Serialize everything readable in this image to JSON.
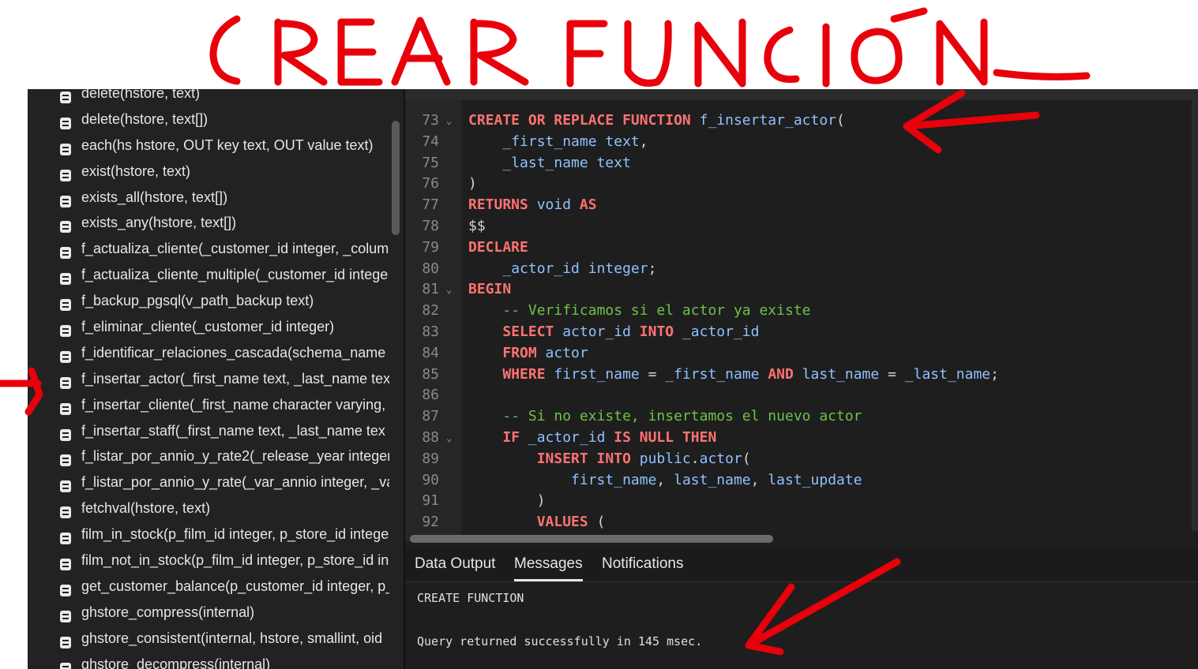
{
  "annotation": {
    "title": "CREAR FUNCIÓN",
    "color": "#e8000a"
  },
  "sidebar": {
    "items": [
      "delete(hstore, text)",
      "delete(hstore, text[])",
      "each(hs hstore, OUT key text, OUT value text)",
      "exist(hstore, text)",
      "exists_all(hstore, text[])",
      "exists_any(hstore, text[])",
      "f_actualiza_cliente(_customer_id integer, _colum",
      "f_actualiza_cliente_multiple(_customer_id intege",
      "f_backup_pgsql(v_path_backup text)",
      "f_eliminar_cliente(_customer_id integer)",
      "f_identificar_relaciones_cascada(schema_name",
      "f_insertar_actor(_first_name text, _last_name tex",
      "f_insertar_cliente(_first_name character varying,",
      "f_insertar_staff(_first_name text, _last_name tex",
      "f_listar_por_annio_y_rate2(_release_year integer,",
      "f_listar_por_annio_y_rate(_var_annio integer, _va",
      "fetchval(hstore, text)",
      "film_in_stock(p_film_id integer, p_store_id intege",
      "film_not_in_stock(p_film_id integer, p_store_id in",
      "get_customer_balance(p_customer_id integer, p_",
      "ghstore_compress(internal)",
      "ghstore_consistent(internal, hstore, smallint, oid",
      "ghstore_decompress(internal)"
    ],
    "icon": "function-icon"
  },
  "editor": {
    "colors": {
      "keyword": "#ff7272",
      "identifier": "#8fc1ff",
      "comment": "#6dc34a"
    },
    "lines": [
      {
        "n": "73",
        "fold": true,
        "tokens": [
          [
            "kw",
            "CREATE OR REPLACE FUNCTION "
          ],
          [
            "id",
            "f_insertar_actor"
          ],
          [
            "op",
            "("
          ]
        ]
      },
      {
        "n": "74",
        "fold": false,
        "tokens": [
          [
            "op",
            "    "
          ],
          [
            "id",
            "_first_name text"
          ],
          [
            "op",
            ","
          ]
        ]
      },
      {
        "n": "75",
        "fold": false,
        "tokens": [
          [
            "op",
            "    "
          ],
          [
            "id",
            "_last_name text"
          ]
        ]
      },
      {
        "n": "76",
        "fold": false,
        "tokens": [
          [
            "op",
            ")"
          ]
        ]
      },
      {
        "n": "77",
        "fold": false,
        "tokens": [
          [
            "kw",
            "RETURNS "
          ],
          [
            "id",
            "void "
          ],
          [
            "kw",
            "AS"
          ]
        ]
      },
      {
        "n": "78",
        "fold": false,
        "tokens": [
          [
            "op",
            "$$"
          ]
        ]
      },
      {
        "n": "79",
        "fold": false,
        "tokens": [
          [
            "kw",
            "DECLARE"
          ]
        ]
      },
      {
        "n": "80",
        "fold": false,
        "tokens": [
          [
            "op",
            "    "
          ],
          [
            "id",
            "_actor_id integer"
          ],
          [
            "op",
            ";"
          ]
        ]
      },
      {
        "n": "81",
        "fold": true,
        "tokens": [
          [
            "kw",
            "BEGIN"
          ]
        ]
      },
      {
        "n": "82",
        "fold": false,
        "tokens": [
          [
            "op",
            "    "
          ],
          [
            "cm",
            "-- Verificamos si el actor ya existe"
          ]
        ]
      },
      {
        "n": "83",
        "fold": false,
        "tokens": [
          [
            "op",
            "    "
          ],
          [
            "kw",
            "SELECT "
          ],
          [
            "id",
            "actor_id "
          ],
          [
            "kw",
            "INTO "
          ],
          [
            "id",
            "_actor_id"
          ]
        ]
      },
      {
        "n": "84",
        "fold": false,
        "tokens": [
          [
            "op",
            "    "
          ],
          [
            "kw",
            "FROM "
          ],
          [
            "id",
            "actor"
          ]
        ]
      },
      {
        "n": "85",
        "fold": false,
        "tokens": [
          [
            "op",
            "    "
          ],
          [
            "kw",
            "WHERE "
          ],
          [
            "id",
            "first_name "
          ],
          [
            "op",
            "= "
          ],
          [
            "id",
            "_first_name "
          ],
          [
            "kw",
            "AND "
          ],
          [
            "id",
            "last_name "
          ],
          [
            "op",
            "= "
          ],
          [
            "id",
            "_last_name"
          ],
          [
            "op",
            ";"
          ]
        ]
      },
      {
        "n": "86",
        "fold": false,
        "tokens": []
      },
      {
        "n": "87",
        "fold": false,
        "tokens": [
          [
            "op",
            "    "
          ],
          [
            "cm",
            "-- Si no existe, insertamos el nuevo actor"
          ]
        ]
      },
      {
        "n": "88",
        "fold": true,
        "tokens": [
          [
            "op",
            "    "
          ],
          [
            "kw",
            "IF "
          ],
          [
            "id",
            "_actor_id "
          ],
          [
            "kw",
            "IS NULL THEN"
          ]
        ]
      },
      {
        "n": "89",
        "fold": false,
        "tokens": [
          [
            "op",
            "        "
          ],
          [
            "kw",
            "INSERT INTO "
          ],
          [
            "id",
            "public"
          ],
          [
            "op",
            "."
          ],
          [
            "id",
            "actor"
          ],
          [
            "op",
            "("
          ]
        ]
      },
      {
        "n": "90",
        "fold": false,
        "tokens": [
          [
            "op",
            "            "
          ],
          [
            "id",
            "first_name"
          ],
          [
            "op",
            ", "
          ],
          [
            "id",
            "last_name"
          ],
          [
            "op",
            ", "
          ],
          [
            "id",
            "last_update"
          ]
        ]
      },
      {
        "n": "91",
        "fold": false,
        "tokens": [
          [
            "op",
            "        )"
          ]
        ]
      },
      {
        "n": "92",
        "fold": false,
        "tokens": [
          [
            "op",
            "        "
          ],
          [
            "kw",
            "VALUES "
          ],
          [
            "op",
            "("
          ]
        ]
      }
    ]
  },
  "output": {
    "tabs": [
      "Data Output",
      "Messages",
      "Notifications"
    ],
    "active_tab": "Messages",
    "messages": [
      "CREATE FUNCTION",
      "Query returned successfully in 145 msec."
    ]
  }
}
